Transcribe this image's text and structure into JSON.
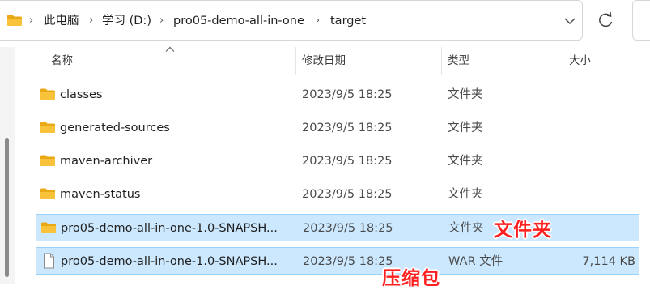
{
  "breadcrumb": {
    "items": [
      "此电脑",
      "学习 (D:)",
      "pro05-demo-all-in-one",
      "target"
    ]
  },
  "columns": {
    "name": "名称",
    "date": "修改日期",
    "type": "类型",
    "size": "大小"
  },
  "rows": [
    {
      "name": "classes",
      "date": "2023/9/5 18:25",
      "type": "文件夹",
      "size": "",
      "kind": "folder",
      "selected": false
    },
    {
      "name": "generated-sources",
      "date": "2023/9/5 18:25",
      "type": "文件夹",
      "size": "",
      "kind": "folder",
      "selected": false
    },
    {
      "name": "maven-archiver",
      "date": "2023/9/5 18:25",
      "type": "文件夹",
      "size": "",
      "kind": "folder",
      "selected": false
    },
    {
      "name": "maven-status",
      "date": "2023/9/5 18:25",
      "type": "文件夹",
      "size": "",
      "kind": "folder",
      "selected": false
    },
    {
      "name": "pro05-demo-all-in-one-1.0-SNAPSH...",
      "date": "2023/9/5 18:25",
      "type": "文件夹",
      "size": "",
      "kind": "folder",
      "selected": true
    },
    {
      "name": "pro05-demo-all-in-one-1.0-SNAPSH...",
      "date": "2023/9/5 18:25",
      "type": "WAR 文件",
      "size": "7,114 KB",
      "kind": "file",
      "selected": true
    }
  ],
  "annotations": {
    "folder_note": "文件夹",
    "archive_note": "压缩包"
  },
  "colors": {
    "selection_bg": "#cce8ff",
    "selection_border": "#99d1ff",
    "folder_yellow": "#f8c33a",
    "annotation_red": "#ff2020"
  },
  "icons": {
    "location": "folder-icon",
    "expand": "chevron-down-icon",
    "refresh": "refresh-icon",
    "sort": "sort-up-arrow-icon"
  }
}
